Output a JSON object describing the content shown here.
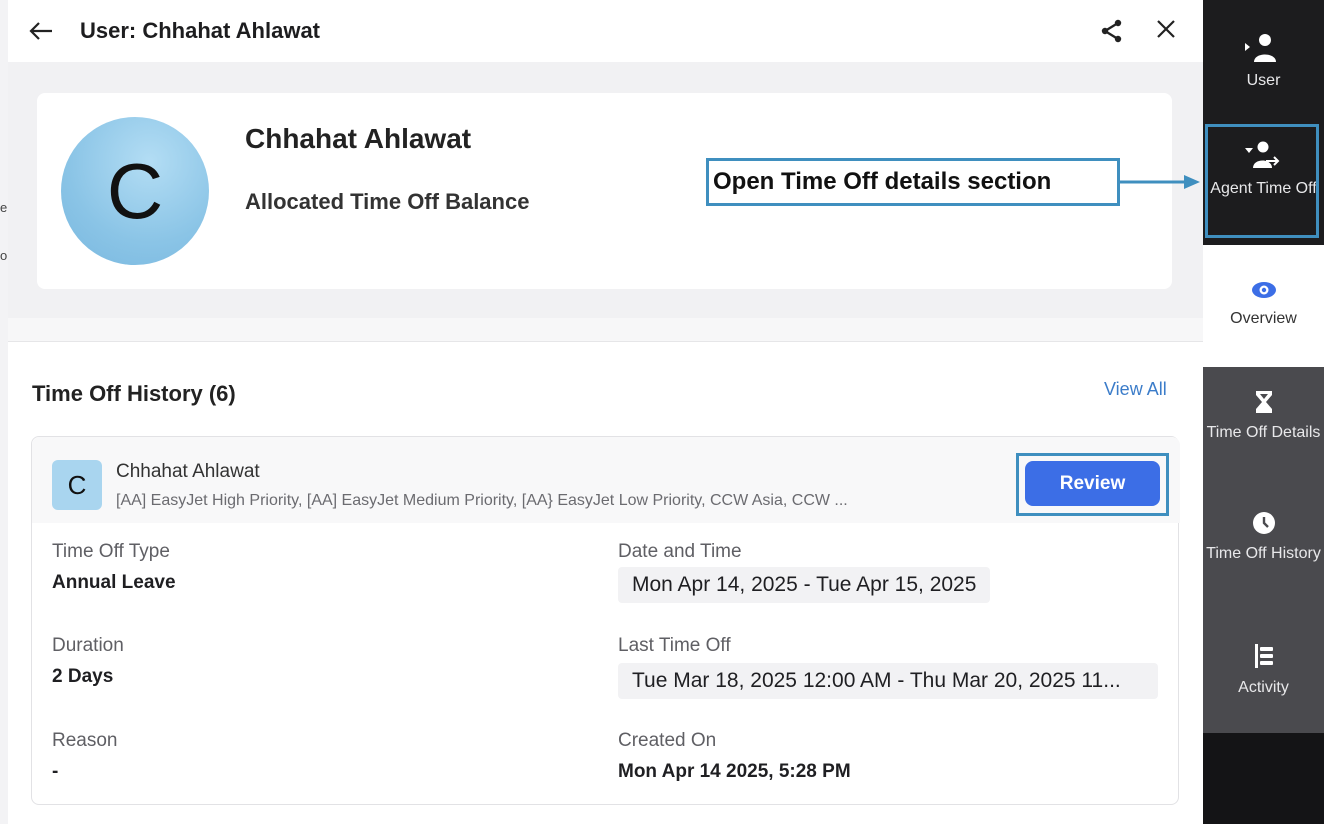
{
  "header": {
    "title": "User: Chhahat Ahlawat"
  },
  "profile": {
    "initial": "C",
    "name": "Chhahat Ahlawat",
    "balance_label": "Allocated Time Off Balance"
  },
  "history": {
    "title": "Time Off History (6)",
    "view_all": "View All",
    "request": {
      "initial": "C",
      "name": "Chhahat Ahlawat",
      "queues": "[AA] EasyJet High Priority, [AA] EasyJet Medium Priority, [AA} EasyJet Low Priority, CCW Asia, CCW ...",
      "review_label": "Review",
      "fields": {
        "type_label": "Time Off Type",
        "type_value": "Annual Leave",
        "date_label": "Date and Time",
        "date_value": "Mon Apr 14, 2025 - Tue Apr 15, 2025",
        "duration_label": "Duration",
        "duration_value": "2 Days",
        "last_label": "Last Time Off",
        "last_value": "Tue Mar 18, 2025 12:00 AM - Thu Mar 20, 2025 11...",
        "reason_label": "Reason",
        "reason_value": "-",
        "created_label": "Created On",
        "created_value": "Mon Apr 14 2025, 5:28 PM"
      }
    }
  },
  "rail": {
    "user": "User",
    "agent_time_off": "Agent Time Off",
    "overview": "Overview",
    "time_off_details": "Time Off Details",
    "time_off_history": "Time Off History",
    "activity": "Activity"
  },
  "annotation": {
    "callout": "Open Time Off details section"
  },
  "underlying": {
    "fragment_1": "e",
    "fragment_2": "o"
  },
  "colors": {
    "primary_button": "#3c6ee6",
    "annotation": "#3f8fbf",
    "link": "#3b7cc9",
    "rail_dark": "#1f1f21",
    "rail_mid": "#4a4a4e"
  },
  "icons": [
    "back-arrow-icon",
    "share-icon",
    "close-icon",
    "user-icon",
    "agent-time-off-icon",
    "eye-icon",
    "hourglass-icon",
    "clock-icon",
    "activity-icon"
  ]
}
